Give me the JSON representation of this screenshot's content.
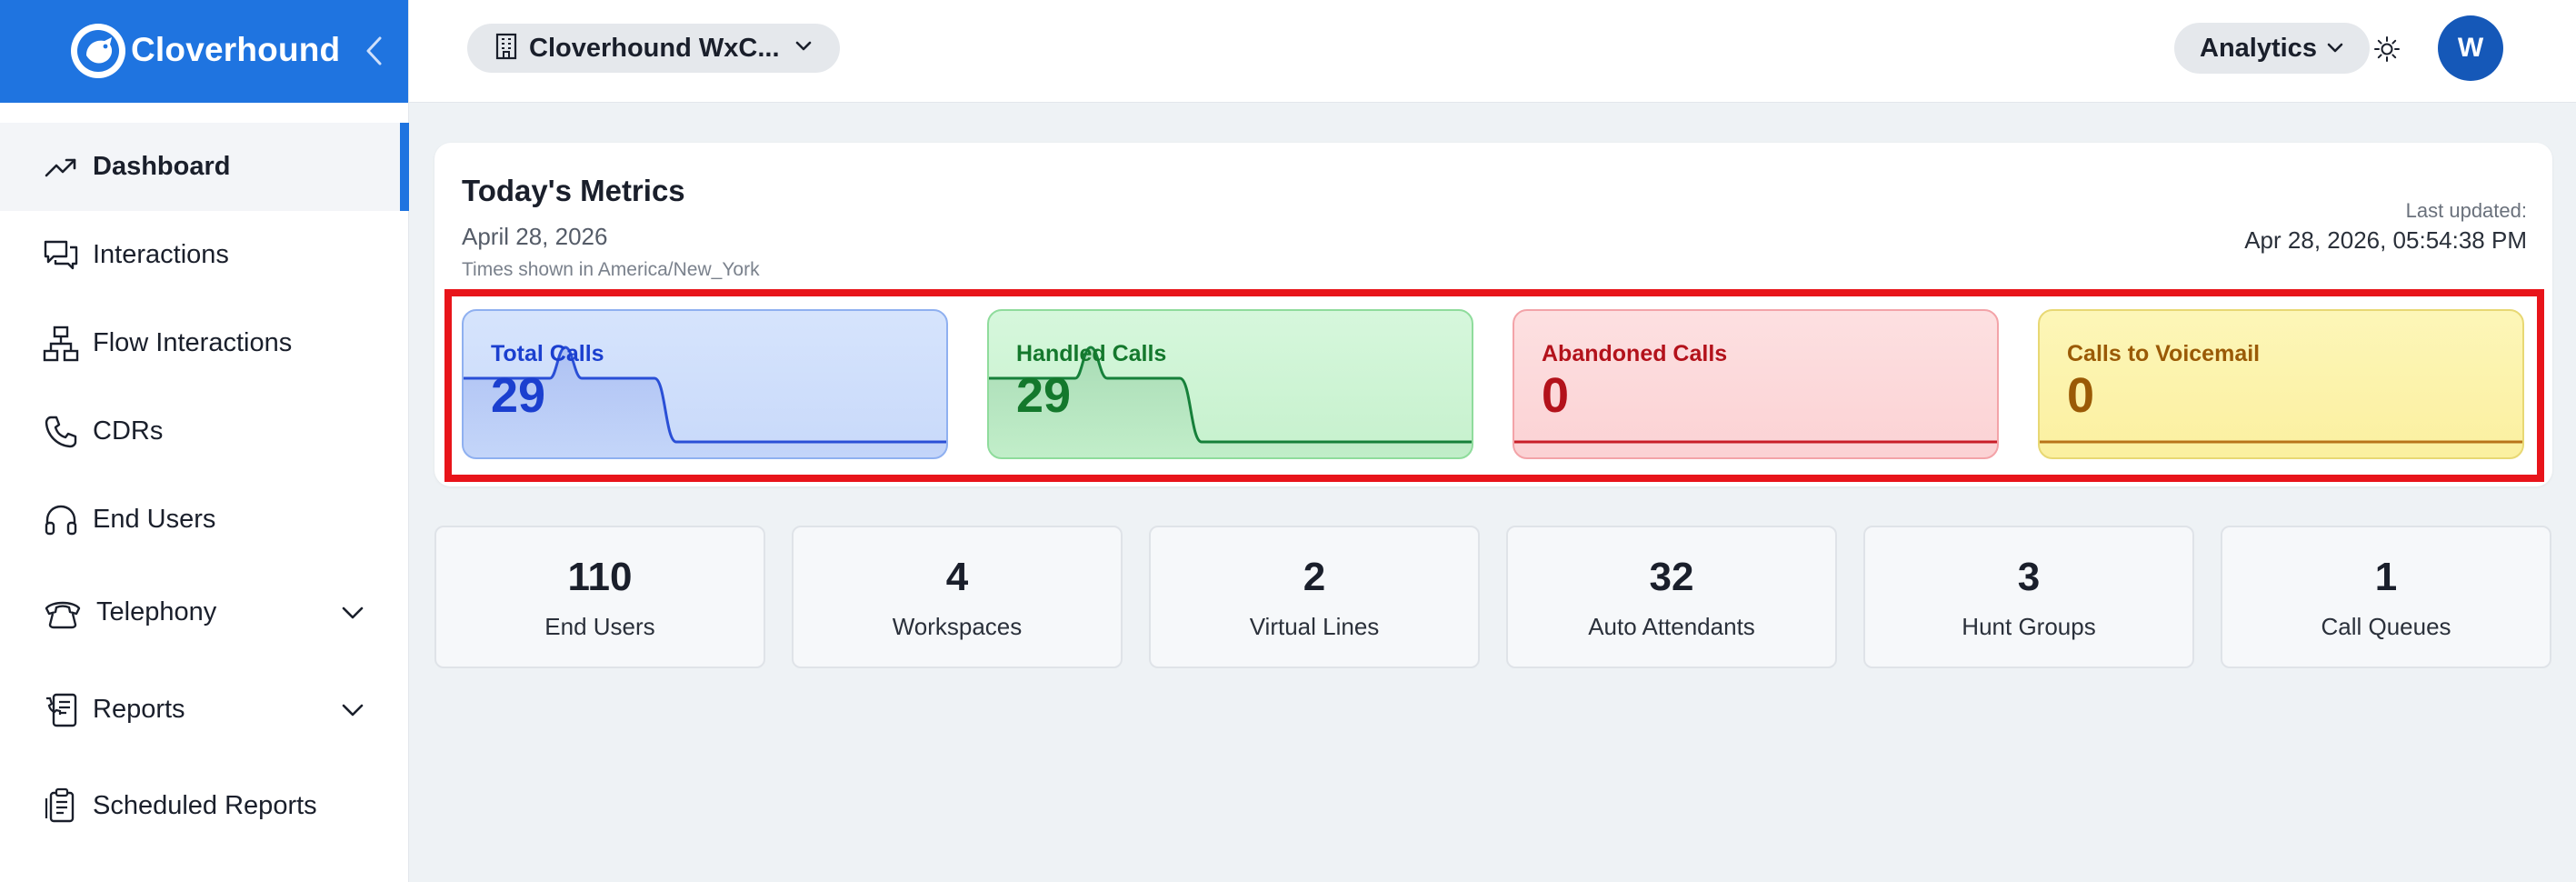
{
  "app": {
    "brand_name": "Cloverhound",
    "accent_color": "#1f74e0"
  },
  "sidebar": {
    "items": [
      {
        "label": "Dashboard",
        "icon": "trending-up-icon",
        "active": true
      },
      {
        "label": "Interactions",
        "icon": "chat-bubbles-icon"
      },
      {
        "label": "Flow Interactions",
        "icon": "flow-tree-icon"
      },
      {
        "label": "CDRs",
        "icon": "phone-icon"
      },
      {
        "label": "End Users",
        "icon": "headset-icon"
      },
      {
        "label": "Telephony",
        "icon": "telephone-icon",
        "expandable": true
      },
      {
        "label": "Reports",
        "icon": "call-report-icon",
        "expandable": true
      },
      {
        "label": "Scheduled Reports",
        "icon": "clipboard-list-icon"
      }
    ]
  },
  "topbar": {
    "org_name": "Cloverhound WxC...",
    "analytics_label": "Analytics",
    "avatar_initial": "W"
  },
  "metrics": {
    "title": "Today's Metrics",
    "date": "April 28, 2026",
    "timezone_note": "Times shown in America/New_York",
    "last_updated_label": "Last updated:",
    "last_updated_value": "Apr 28, 2026, 05:54:38 PM",
    "tiles": [
      {
        "label": "Total Calls",
        "value": "29",
        "color": "#1b3fcf"
      },
      {
        "label": "Handled Calls",
        "value": "29",
        "color": "#14782c"
      },
      {
        "label": "Abandoned Calls",
        "value": "0",
        "color": "#b3121b"
      },
      {
        "label": "Calls to Voicemail",
        "value": "0",
        "color": "#9a5a06"
      }
    ]
  },
  "stats": [
    {
      "value": "110",
      "label": "End Users"
    },
    {
      "value": "4",
      "label": "Workspaces"
    },
    {
      "value": "2",
      "label": "Virtual Lines"
    },
    {
      "value": "32",
      "label": "Auto Attendants"
    },
    {
      "value": "3",
      "label": "Hunt Groups"
    },
    {
      "value": "1",
      "label": "Call Queues"
    }
  ]
}
